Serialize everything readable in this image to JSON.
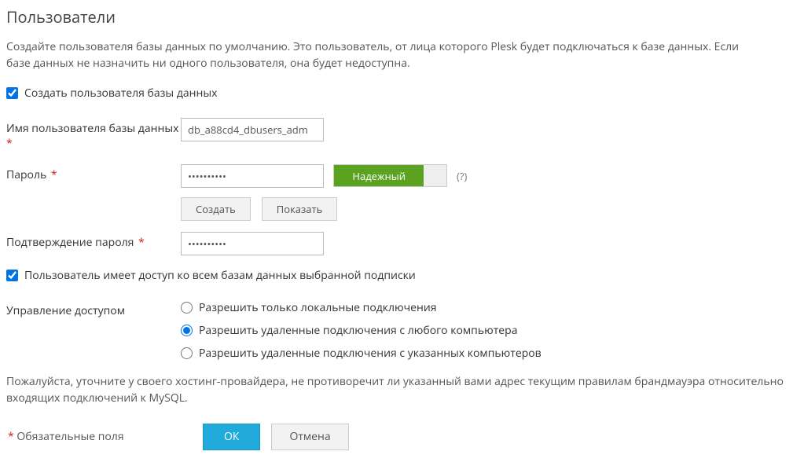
{
  "heading": "Пользователи",
  "intro": "Создайте пользователя базы данных по умолчанию. Это пользователь, от лица которого Plesk будет подключаться к базе данных. Если базе данных не назначить ни одного пользователя, она будет недоступна.",
  "create_user_checkbox": "Создать пользователя базы данных",
  "create_user_checked": true,
  "username_label": "Имя пользователя базы данных",
  "username_value": "db_a88cd4_dbusers_adm",
  "password_label": "Пароль",
  "password_value": "••••••••••",
  "strength_label": "Надежный",
  "help_marker": "(?)",
  "generate_btn": "Создать",
  "show_btn": "Показать",
  "confirm_label": "Подтверждение пароля",
  "confirm_value": "••••••••••",
  "all_db_checkbox": "Пользователь имеет доступ ко всем базам данных выбранной подписки",
  "all_db_checked": true,
  "access_label": "Управление доступом",
  "access_options": [
    "Разрешить только локальные подключения",
    "Разрешить удаленные подключения с любого компьютера",
    "Разрешить удаленные подключения с указанных компьютеров"
  ],
  "access_selected_index": 1,
  "firewall_note": "Пожалуйста, уточните у своего хостинг-провайдера, не противоречит ли указанный вами адрес текущим правилам брандмауэра относительно входящих подключений к MySQL.",
  "required_note": "Обязательные поля",
  "ok_btn": "ОК",
  "cancel_btn": "Отмена"
}
